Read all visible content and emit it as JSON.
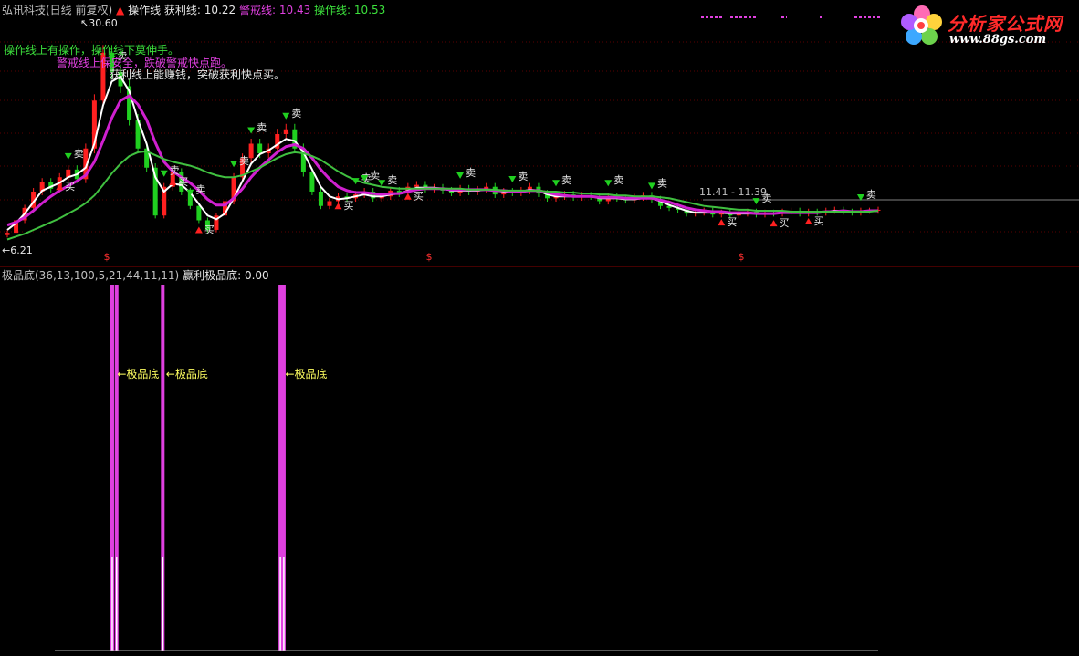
{
  "header": {
    "stock_name": "弘讯科技(日线 前复权)",
    "caozuo_label": "操作线",
    "huoli_label": "获利线:",
    "huoli_value": "10.22",
    "jingjie_label": "警戒线:",
    "jingjie_value": "10.43",
    "caozuo2_label": "操作线:",
    "caozuo2_value": "10.53"
  },
  "annotations": {
    "line1": "操作线上有操作，操作线下莫伸手。",
    "line2": "警戒线上保安全，跌破警戒快点跑。",
    "line3": "获利线上能赚钱，突破获利快点买。"
  },
  "logo": {
    "cn": "分析家公式网",
    "url": "www.88gs.com"
  },
  "colors": {
    "bg": "#000000",
    "up": "#ff2020",
    "down": "#20d020",
    "white_line": "#ffffff",
    "magenta_line": "#d020d0",
    "green_line": "#40c040",
    "yellow": "#ffff60",
    "histogram": "#e040e0"
  },
  "chart_data": [
    {
      "type": "line",
      "panel": "main",
      "y_scale": "price",
      "ylim": [
        6.21,
        30.6
      ],
      "max_label": "30.60",
      "min_label": "6.21",
      "range_label": "11.41 - 11.39",
      "grid": true,
      "x": [
        0,
        1,
        2,
        3,
        4,
        5,
        6,
        7,
        8,
        9,
        10,
        11,
        12,
        13,
        14,
        15,
        16,
        17,
        18,
        19,
        20,
        21,
        22,
        23,
        24,
        25,
        26,
        27,
        28,
        29,
        30,
        31,
        32,
        33,
        34,
        35,
        36,
        37,
        38,
        39,
        40,
        41,
        42,
        43,
        44,
        45,
        46,
        47,
        48,
        49,
        50,
        51,
        52,
        53,
        54,
        55,
        56,
        57,
        58,
        59,
        60,
        61,
        62,
        63,
        64,
        65,
        66,
        67,
        68,
        69,
        70,
        71,
        72,
        73,
        74,
        75,
        76,
        77,
        78,
        79,
        80,
        81,
        82,
        83,
        84,
        85,
        86,
        87,
        88,
        89,
        90,
        91,
        92,
        93,
        94,
        95,
        96,
        97,
        98,
        99,
        100
      ],
      "series": [
        {
          "name": "close",
          "values": [
            8.2,
            9.5,
            10.8,
            12.5,
            13.5,
            12.8,
            14.0,
            14.8,
            13.8,
            17.0,
            22.0,
            27.0,
            25.0,
            23.5,
            20.0,
            17.0,
            15.0,
            10.0,
            13.0,
            14.5,
            12.5,
            11.0,
            9.5,
            8.5,
            10.0,
            11.5,
            14.0,
            16.0,
            17.5,
            16.5,
            17.0,
            18.5,
            19.0,
            17.0,
            14.5,
            12.5,
            11.0,
            11.5,
            12.0,
            11.8,
            12.2,
            12.5,
            11.8,
            12.0,
            12.6,
            12.3,
            13.0,
            13.2,
            12.8,
            12.9,
            12.6,
            12.4,
            12.8,
            12.5,
            12.7,
            13.0,
            12.2,
            12.5,
            12.4,
            12.6,
            13.0,
            12.3,
            11.8,
            12.0,
            12.2,
            11.9,
            12.1,
            12.0,
            11.5,
            12.0,
            11.8,
            11.6,
            11.9,
            12.1,
            11.7,
            11.0,
            10.8,
            10.6,
            10.2,
            10.3,
            10.5,
            10.1,
            10.3,
            10.0,
            10.2,
            10.4,
            10.1,
            10.3,
            10.2,
            10.4,
            10.5,
            10.2,
            10.4,
            10.3,
            10.5,
            10.6,
            10.4,
            10.3,
            10.5,
            10.5,
            10.6
          ]
        },
        {
          "name": "ma_fast",
          "values": [
            8.5,
            9.2,
            10.2,
            11.4,
            12.6,
            13.0,
            13.4,
            14.0,
            14.3,
            15.0,
            17.5,
            21.5,
            24.0,
            24.5,
            23.0,
            20.0,
            17.5,
            14.0,
            12.5,
            13.3,
            13.2,
            12.4,
            11.2,
            10.0,
            9.6,
            10.2,
            11.8,
            13.6,
            15.4,
            16.4,
            16.8,
            17.4,
            18.0,
            17.8,
            16.6,
            14.8,
            13.0,
            12.0,
            11.7,
            11.8,
            12.0,
            12.2,
            12.0,
            12.0,
            12.2,
            12.3,
            12.6,
            12.9,
            12.9,
            12.9,
            12.8,
            12.6,
            12.6,
            12.6,
            12.6,
            12.7,
            12.6,
            12.5,
            12.4,
            12.5,
            12.7,
            12.6,
            12.2,
            12.0,
            12.0,
            12.0,
            12.0,
            12.0,
            11.8,
            11.8,
            11.8,
            11.7,
            11.7,
            11.8,
            11.8,
            11.5,
            11.1,
            10.8,
            10.5,
            10.3,
            10.3,
            10.3,
            10.3,
            10.2,
            10.2,
            10.2,
            10.2,
            10.2,
            10.2,
            10.3,
            10.3,
            10.3,
            10.3,
            10.3,
            10.4,
            10.5,
            10.5,
            10.4,
            10.4,
            10.5,
            10.5
          ]
        },
        {
          "name": "ma_mid",
          "values": [
            9.0,
            9.3,
            9.8,
            10.5,
            11.3,
            12.0,
            12.6,
            13.1,
            13.6,
            14.2,
            15.6,
            17.8,
            20.2,
            22.0,
            22.5,
            21.6,
            20.0,
            17.6,
            15.6,
            14.6,
            14.0,
            13.4,
            12.6,
            11.7,
            11.1,
            11.1,
            11.8,
            12.8,
            14.0,
            15.0,
            15.8,
            16.6,
            17.2,
            17.4,
            17.0,
            16.0,
            14.8,
            13.8,
            13.0,
            12.6,
            12.4,
            12.4,
            12.3,
            12.2,
            12.3,
            12.3,
            12.5,
            12.7,
            12.8,
            12.8,
            12.8,
            12.7,
            12.7,
            12.7,
            12.7,
            12.7,
            12.6,
            12.6,
            12.5,
            12.5,
            12.6,
            12.6,
            12.4,
            12.2,
            12.1,
            12.0,
            12.0,
            12.0,
            11.9,
            11.9,
            11.9,
            11.8,
            11.8,
            11.8,
            11.8,
            11.6,
            11.4,
            11.1,
            10.8,
            10.6,
            10.5,
            10.4,
            10.4,
            10.3,
            10.3,
            10.3,
            10.2,
            10.2,
            10.2,
            10.3,
            10.3,
            10.3,
            10.3,
            10.3,
            10.4,
            10.4,
            10.5,
            10.4,
            10.4,
            10.5,
            10.5
          ]
        },
        {
          "name": "ma_slow",
          "values": [
            7.5,
            7.8,
            8.1,
            8.5,
            8.9,
            9.3,
            9.7,
            10.2,
            10.7,
            11.3,
            12.1,
            13.2,
            14.4,
            15.4,
            16.2,
            16.6,
            16.7,
            16.3,
            15.9,
            15.6,
            15.4,
            15.2,
            14.9,
            14.5,
            14.2,
            14.0,
            14.0,
            14.2,
            14.6,
            15.0,
            15.5,
            16.0,
            16.4,
            16.6,
            16.5,
            16.2,
            15.8,
            15.2,
            14.6,
            14.1,
            13.7,
            13.4,
            13.2,
            13.0,
            12.9,
            12.8,
            12.8,
            12.8,
            12.8,
            12.8,
            12.8,
            12.8,
            12.8,
            12.7,
            12.7,
            12.7,
            12.7,
            12.6,
            12.6,
            12.6,
            12.6,
            12.6,
            12.5,
            12.5,
            12.4,
            12.4,
            12.3,
            12.3,
            12.2,
            12.2,
            12.1,
            12.1,
            12.0,
            12.0,
            12.0,
            11.9,
            11.8,
            11.6,
            11.4,
            11.2,
            11.0,
            10.9,
            10.8,
            10.7,
            10.6,
            10.6,
            10.5,
            10.5,
            10.5,
            10.5,
            10.4,
            10.4,
            10.4,
            10.4,
            10.4,
            10.4,
            10.4,
            10.4,
            10.4,
            10.4,
            10.5
          ]
        }
      ],
      "signals": [
        {
          "x": 6,
          "label": "买"
        },
        {
          "x": 7,
          "label": "卖"
        },
        {
          "x": 12,
          "label": "卖"
        },
        {
          "x": 18,
          "label": "卖"
        },
        {
          "x": 19,
          "label": "买"
        },
        {
          "x": 21,
          "label": "卖"
        },
        {
          "x": 22,
          "label": "买"
        },
        {
          "x": 26,
          "label": "卖"
        },
        {
          "x": 28,
          "label": "卖"
        },
        {
          "x": 32,
          "label": "卖"
        },
        {
          "x": 38,
          "label": "买"
        },
        {
          "x": 40,
          "label": "卖"
        },
        {
          "x": 41,
          "label": "卖"
        },
        {
          "x": 43,
          "label": "卖"
        },
        {
          "x": 46,
          "label": "买"
        },
        {
          "x": 52,
          "label": "卖"
        },
        {
          "x": 58,
          "label": "卖"
        },
        {
          "x": 63,
          "label": "卖"
        },
        {
          "x": 69,
          "label": "卖"
        },
        {
          "x": 74,
          "label": "卖"
        },
        {
          "x": 82,
          "label": "买"
        },
        {
          "x": 86,
          "label": "卖"
        },
        {
          "x": 88,
          "label": "买"
        },
        {
          "x": 92,
          "label": "买"
        },
        {
          "x": 98,
          "label": "卖"
        }
      ]
    },
    {
      "type": "bar",
      "panel": "sub",
      "title": "极品底(36,13,100,5,21,44,11,11)",
      "value_label": "赢利极品底:",
      "value": "0.00",
      "ylim": [
        0,
        1
      ],
      "signal_label": "极品底",
      "bars": [
        {
          "x": 12,
          "value": 1.0
        },
        {
          "x": 12.5,
          "value": 1.0
        },
        {
          "x": 17.8,
          "value": 1.0
        },
        {
          "x": 31.3,
          "value": 1.0
        },
        {
          "x": 31.7,
          "value": 1.0
        }
      ]
    }
  ]
}
